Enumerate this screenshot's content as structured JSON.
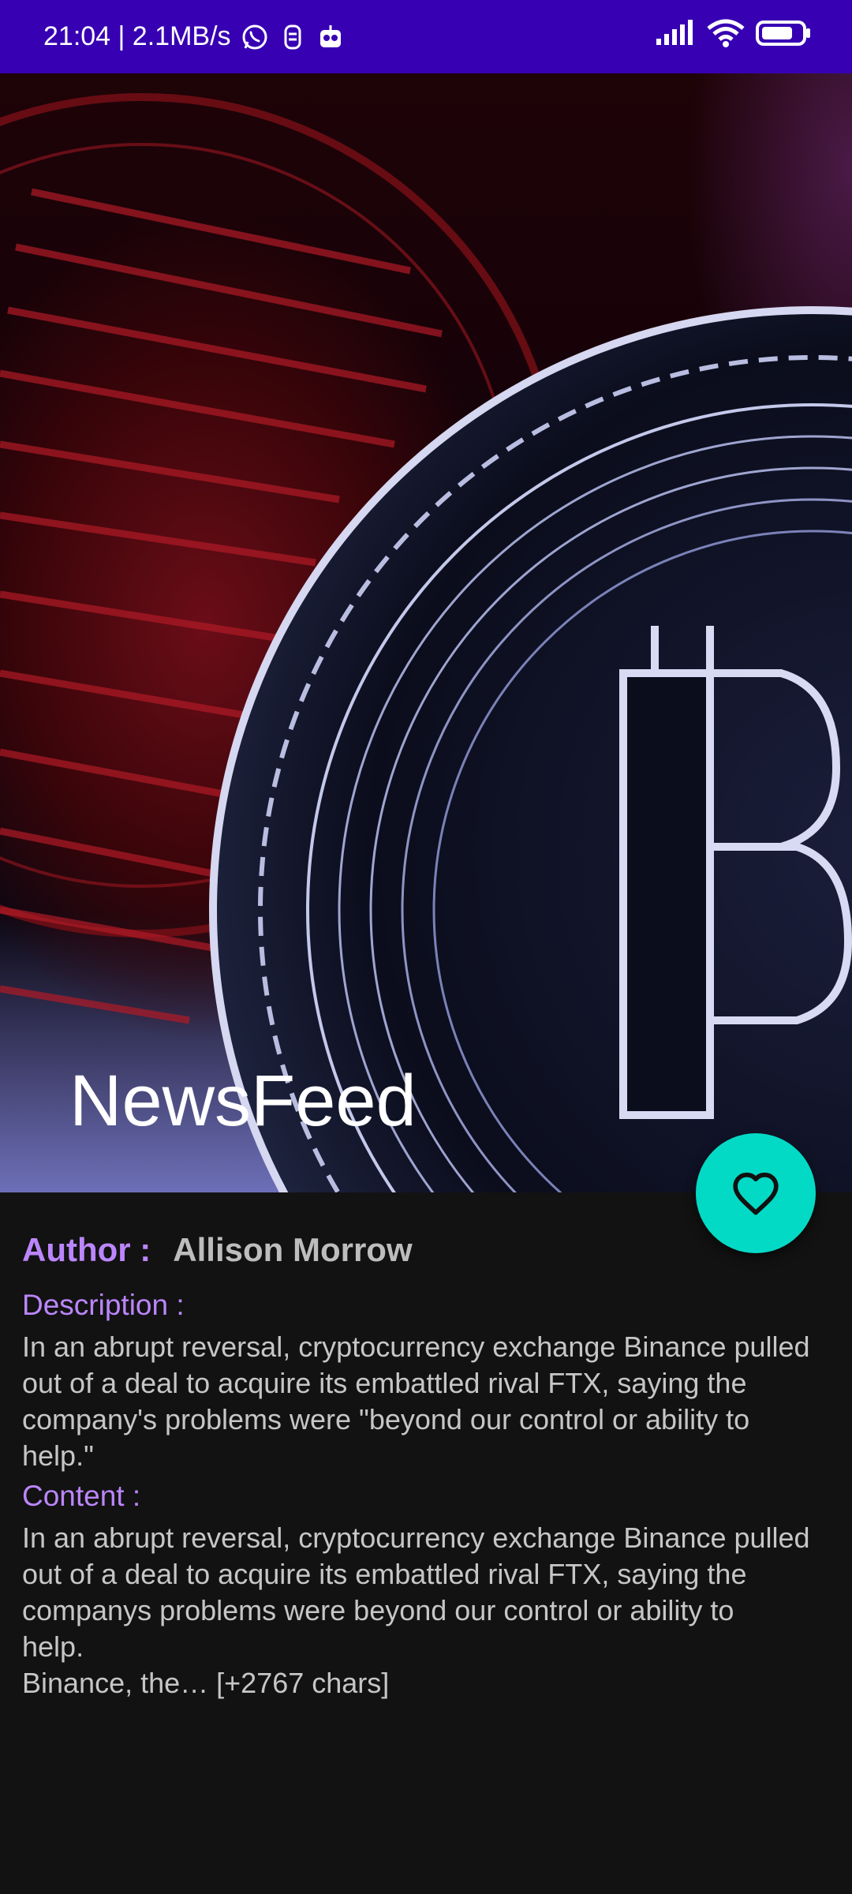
{
  "status_bar": {
    "time_speed": "21:04 | 2.1MB/s",
    "icons": [
      "whatsapp-icon",
      "notification-icon",
      "bot-icon"
    ],
    "right_icons": [
      "signal-icon",
      "wifi-icon",
      "battery-icon"
    ]
  },
  "toolbar": {
    "title": "NewsFeed",
    "header_image": "bitcoin coin image"
  },
  "fab": {
    "icon": "heart-outline-icon",
    "color": "#03DAC5"
  },
  "article": {
    "author_label": "Author :",
    "author": "Allison Morrow",
    "description_label": "Description :",
    "description": "In an abrupt reversal, cryptocurrency exchange Binance pulled\nout of a deal to acquire its embattled rival FTX, saying the\ncompany's problems were \"beyond our control or ability to\nhelp.\"",
    "content_label": "Content :",
    "content": "In an abrupt reversal, cryptocurrency exchange Binance pulled\nout of a deal to acquire its embattled rival FTX, saying the\ncompanys problems were beyond our control or ability to\nhelp.\nBinance, the… [+2767 chars]"
  },
  "colors": {
    "status_bar": "#3700B3",
    "accent": "#BB86FC",
    "background": "#121212"
  }
}
